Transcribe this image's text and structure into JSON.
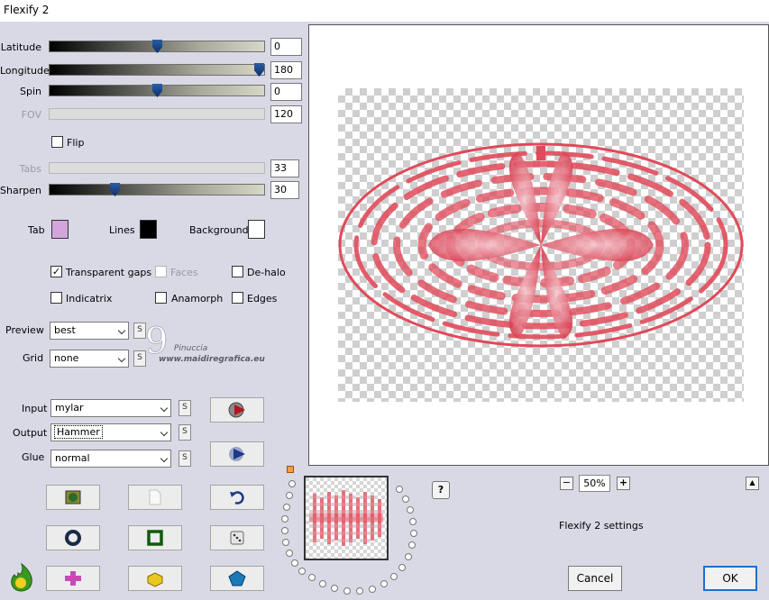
{
  "window": {
    "title": "Flexify 2"
  },
  "sliders": [
    {
      "label": "Latitude",
      "value": "0",
      "level": 0.5,
      "enabled": true
    },
    {
      "label": "Longitude",
      "value": "180",
      "level": 1.0,
      "enabled": true
    },
    {
      "label": "Spin",
      "value": "0",
      "level": 0.5,
      "enabled": true
    },
    {
      "label": "FOV",
      "value": "120",
      "enabled": false
    },
    {
      "label": "Tabs",
      "value": "33",
      "enabled": false
    },
    {
      "label": "Sharpen",
      "value": "30",
      "level": 0.3,
      "enabled": true
    }
  ],
  "flip": {
    "label": "Flip",
    "checked": false
  },
  "colors": {
    "tab": {
      "label": "Tab",
      "color": "#d4a5dd"
    },
    "lines": {
      "label": "Lines",
      "color": "#000000"
    },
    "background": {
      "label": "Background",
      "color": "#ffffff"
    }
  },
  "options": {
    "transparent_gaps": {
      "label": "Transparent gaps",
      "checked": true
    },
    "faces": {
      "label": "Faces",
      "checked": false,
      "enabled": false
    },
    "de_halo": {
      "label": "De-halo",
      "checked": false
    },
    "indicatrix": {
      "label": "Indicatrix",
      "checked": false
    },
    "anamorph": {
      "label": "Anamorph",
      "checked": false
    },
    "edges": {
      "label": "Edges",
      "checked": false
    }
  },
  "preview": {
    "label": "Preview",
    "value": "best"
  },
  "grid": {
    "label": "Grid",
    "value": "none"
  },
  "input": {
    "label": "Input",
    "value": "mylar"
  },
  "output": {
    "label": "Output",
    "value": "Hammer"
  },
  "glue": {
    "label": "Glue",
    "value": "normal"
  },
  "s_button_label": "S",
  "watermark": {
    "line1": "Pinuccia",
    "line2": "www.maidiregrafica.eu"
  },
  "zoom": {
    "value": "50%",
    "minus": "−",
    "plus": "+"
  },
  "help_label": "?",
  "collapse_label": "▲",
  "status_text": "Flexify 2 settings",
  "buttons": {
    "cancel": "Cancel",
    "ok": "OK"
  },
  "accent_color": "#1e6fd0",
  "mark_color": "#e04a5a"
}
